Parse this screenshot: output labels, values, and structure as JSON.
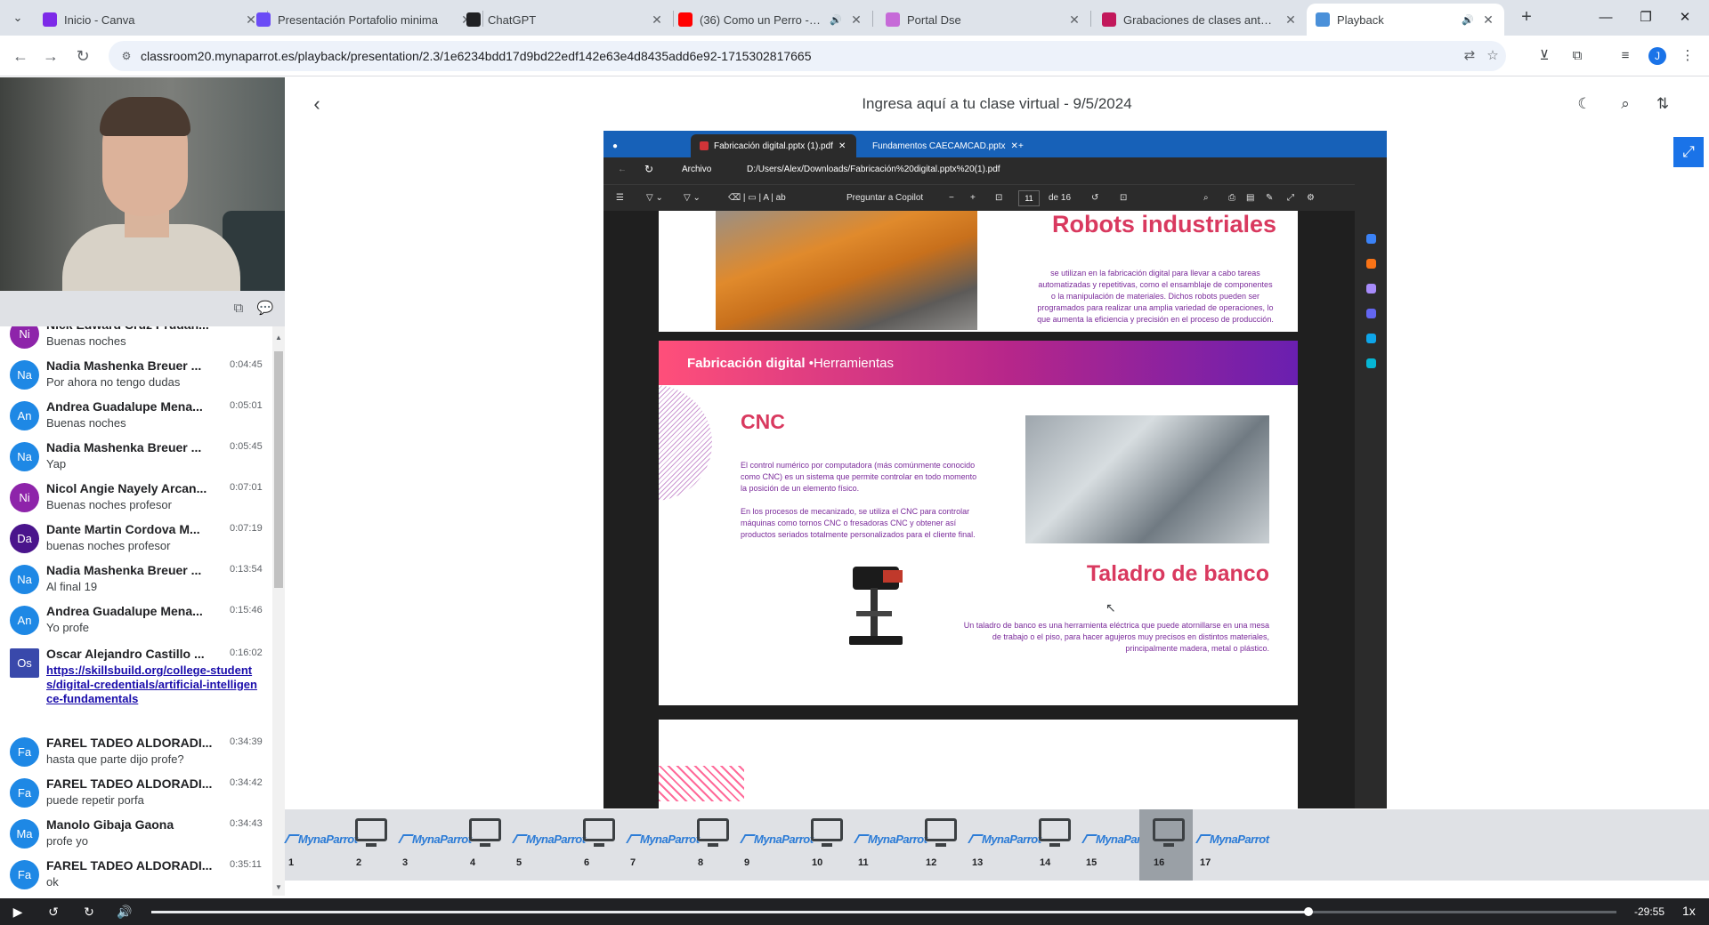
{
  "browser": {
    "tabs": [
      {
        "label": "Inicio - Canva",
        "favicon_color": "#7d2ae8"
      },
      {
        "label": "Presentación Portafolio minima",
        "favicon_color": "#6b4cf6"
      },
      {
        "label": "ChatGPT",
        "favicon_color": "#202124"
      },
      {
        "label": "(36) Como un Perro - YouTu",
        "favicon_color": "#ff0000",
        "audio": "🔊"
      },
      {
        "label": "Portal Dse",
        "favicon_color": "#c66ad8"
      },
      {
        "label": "Grabaciones de clases anteriore",
        "favicon_color": "#c2185b"
      },
      {
        "label": "Playback",
        "favicon_color": "#4a90d9",
        "audio": "🔊"
      }
    ],
    "url": "classroom20.mynaparrot.es/playback/presentation/2.3/1e6234bdd17d9bd22edf142e63e4d8435add6e92-1715302817665",
    "profile_initial": "J"
  },
  "player": {
    "title": "Ingresa aquí a tu clase virtual - 9/5/2024"
  },
  "shared_screen": {
    "tabs": [
      "Fabricación digital.pptx (1).pdf",
      "Fundamentos CAECAMCAD.pptx"
    ],
    "address_label": "Archivo",
    "address": "D:/Users/Alex/Downloads/Fabricación%20digital.pptx%20(1).pdf",
    "copilot": "Preguntar a Copilot",
    "page_current": "11",
    "page_total": "de 16",
    "slide1": {
      "title": "Robots industriales",
      "text": "se utilizan en la fabricación digital para llevar a cabo tareas automatizadas y repetitivas, como el ensamblaje de componentes o la manipulación de materiales. Dichos robots pueden ser programados para realizar una amplia variedad de operaciones, lo que aumenta la eficiencia y precisión en el proceso de producción."
    },
    "slide2": {
      "banner_bold": "Fabricación digital",
      "banner_rest": " •Herramientas",
      "cnc_title": "CNC",
      "cnc_text1": "El control numérico por computadora (más comúnmente conocido como CNC) es un sistema que permite controlar en todo momento la posición de un elemento físico.",
      "cnc_text2": "En los procesos de mecanizado, se utiliza el CNC para controlar máquinas como tornos CNC o fresadoras CNC y obtener así productos seriados totalmente personalizados para el cliente final.",
      "drill_title": "Taladro de banco",
      "drill_text": "Un taladro de banco es una herramienta eléctrica que puede atornillarse en una mesa de trabajo o el piso, para hacer agujeros muy precisos en distintos materiales, principalmente madera, metal o plástico."
    }
  },
  "chat": {
    "messages": [
      {
        "initials": "Ni",
        "color": "#8e24aa",
        "name": "Nick Edward Cruz Prudan...",
        "time": "",
        "text": "Buenas noches"
      },
      {
        "initials": "Na",
        "color": "#1e88e5",
        "name": "Nadia Mashenka Breuer ...",
        "time": "0:04:45",
        "text": "Por ahora no tengo dudas"
      },
      {
        "initials": "An",
        "color": "#1e88e5",
        "name": "Andrea Guadalupe Mena...",
        "time": "0:05:01",
        "text": "Buenas noches"
      },
      {
        "initials": "Na",
        "color": "#1e88e5",
        "name": "Nadia Mashenka Breuer ...",
        "time": "0:05:45",
        "text": "Yap"
      },
      {
        "initials": "Ni",
        "color": "#8e24aa",
        "name": "Nicol Angie Nayely Arcan...",
        "time": "0:07:01",
        "text": "Buenas noches profesor"
      },
      {
        "initials": "Da",
        "color": "#4a148c",
        "name": "Dante Martin Cordova M...",
        "time": "0:07:19",
        "text": "buenas noches profesor"
      },
      {
        "initials": "Na",
        "color": "#1e88e5",
        "name": "Nadia Mashenka Breuer ...",
        "time": "0:13:54",
        "text": "Al final  19"
      },
      {
        "initials": "An",
        "color": "#1e88e5",
        "name": "Andrea Guadalupe Mena...",
        "time": "0:15:46",
        "text": "Yo profe"
      },
      {
        "initials": "Os",
        "color": "#3949ab",
        "name": "Oscar Alejandro Castillo ...",
        "time": "0:16:02",
        "text": "https://skillsbuild.org/college-students/digital-credentials/artificial-intelligence-fundamentals",
        "link": true
      },
      {
        "initials": "Fa",
        "color": "#1e88e5",
        "name": "FAREL TADEO ALDORADI...",
        "time": "0:34:39",
        "text": "hasta que parte dijo profe?"
      },
      {
        "initials": "Fa",
        "color": "#1e88e5",
        "name": "FAREL TADEO ALDORADI...",
        "time": "0:34:42",
        "text": "puede repetir porfa"
      },
      {
        "initials": "Ma",
        "color": "#1e88e5",
        "name": "Manolo Gibaja Gaona",
        "time": "0:34:43",
        "text": "profe yo"
      },
      {
        "initials": "Fa",
        "color": "#1e88e5",
        "name": "FAREL TADEO ALDORADI...",
        "time": "0:35:11",
        "text": "ok"
      }
    ]
  },
  "slides_strip": {
    "logo_text": "MynaParrot",
    "numbers": [
      "1",
      "2",
      "3",
      "4",
      "5",
      "6",
      "7",
      "8",
      "9",
      "10",
      "11",
      "12",
      "13",
      "14",
      "15",
      "16",
      "17"
    ],
    "active": "16"
  },
  "controls": {
    "time_remaining": "-29:55",
    "speed": "1x",
    "progress": 0.79
  }
}
